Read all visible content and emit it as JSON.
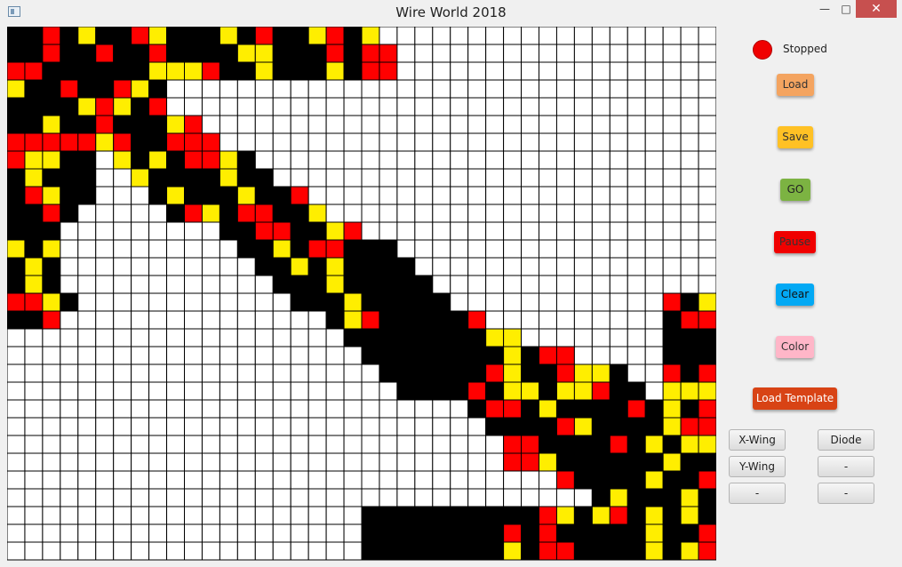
{
  "window": {
    "title": "Wire World 2018",
    "minimize_label": "—",
    "maximize_label": "□",
    "close_label": "✕"
  },
  "status": {
    "text": "Stopped",
    "color": "#f00000"
  },
  "buttons": {
    "load": "Load",
    "save": "Save",
    "go": "GO",
    "pause": "Pause",
    "clear": "Clear",
    "color": "Color",
    "load_template": "Load Template"
  },
  "templates": {
    "x_wing": "X-Wing",
    "diode": "Diode",
    "y_wing": "Y-Wing",
    "slot_a": "-",
    "slot_b": "-",
    "slot_c": "-"
  },
  "cell_colors": {
    "0": "#ffffff",
    "1": "#000000",
    "2": "#ff0000",
    "3": "#ffee00"
  },
  "grid": [
    "1121311231113121132130000000000000000000",
    "1121121121111331112122000000000000000000",
    "2211111133321131113122000000000000000000",
    "3112112310000000000000000000000000000000",
    "1111323120000000000000000000000000000000",
    "1131121113200000000000000000000000000000",
    "2222232112220000000000000000000000000000",
    "2331103131223100000000000000000000000000",
    "1311100311113110000000000000000000000000",
    "1231100013111311200000000000000000000000",
    "1121000001231221130000000000000000000000",
    "1110000000001122113200000000000000000000",
    "3130000000000113122111000000000000000000",
    "1310000000000011313111100000000000000000",
    "1310000000000001113111110000000000000000",
    "2231000000000000111311111000000000000213",
    "1120000000000000001321111120000000000122",
    "0000000000000000000111111113300000000111",
    "0000000000000000000011111111312200000111",
    "0000000000000000000001111112311233100212",
    "0000000000000000000000111121331332110333",
    "0000000000000000000000000012213111121312",
    "0000000000000000000000000001111231111322",
    "0000000000000000000000000000221111213133",
    "0000000000000000000000000000223111111311",
    "0000000000000000000000000000000211113112",
    "0000000000000000000000000000000001311131",
    "0000000000000000000011111111112313213131",
    "0000000000000000000011111111212111113112",
    "0000000000000000000011111111312211113132"
  ]
}
